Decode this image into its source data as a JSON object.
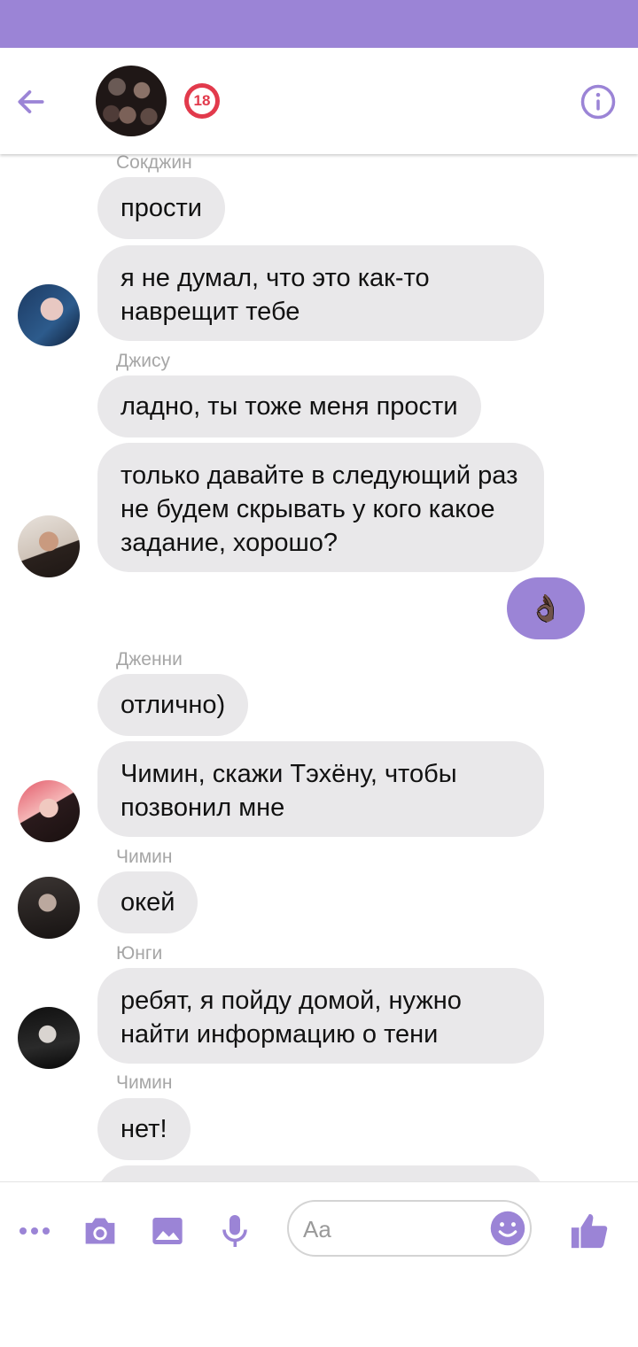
{
  "header": {
    "badge": "18"
  },
  "messages": [
    {
      "sender": "Сокджин",
      "bubbles": [
        "прости",
        "я не думал, что это как-то наврещит тебе"
      ]
    },
    {
      "sender": "Джису",
      "bubbles": [
        "ладно, ты тоже меня прости",
        "только давайте в следующий раз не будем скрывать у кого какое задание, хорошо?"
      ]
    },
    {
      "mine": "👌🏿"
    },
    {
      "sender": "Дженни",
      "bubbles": [
        "отлично)",
        "Чимин, скажи Тэхёну, чтобы позвонил мне"
      ]
    },
    {
      "sender": "Чимин",
      "bubbles": [
        "окей"
      ]
    },
    {
      "sender": "Юнги",
      "bubbles": [
        "ребят, я пойду домой, нужно найти информацию о тени"
      ]
    },
    {
      "sender": "Чимин",
      "bubbles": [
        "нет!"
      ]
    }
  ],
  "composer": {
    "placeholder": "Aa"
  },
  "colors": {
    "accent": "#9b84d6",
    "bubble": "#e9e8ea",
    "badge": "#e23a4c"
  }
}
